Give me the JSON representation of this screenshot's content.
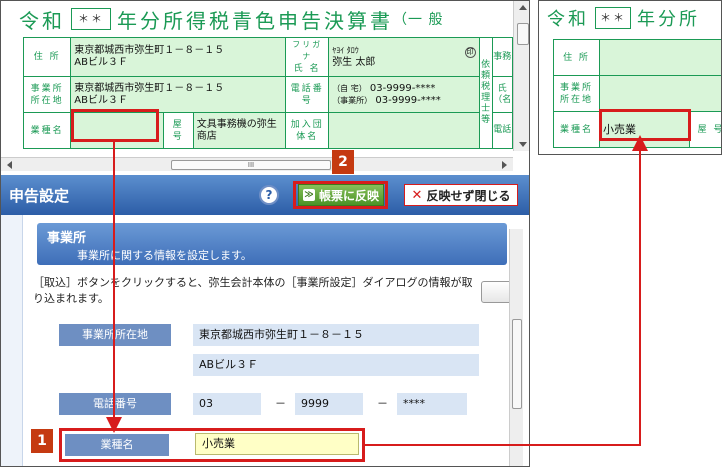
{
  "form": {
    "title_prefix": "令和",
    "era_value": "＊＊",
    "title_main": "年分所得税青色申告決算書",
    "title_kind": "（一 般",
    "labels": {
      "address": "住 所",
      "office_address": "事業所所在地",
      "business_type": "業種名",
      "shop_name": "屋 号",
      "association": "加入団体名",
      "furigana": "フリガナ",
      "name": "氏 名",
      "phone": "電話番号",
      "requester": "依頼税理士等",
      "office_right": "事務",
      "name_right": "氏（名",
      "phone_right": "電話"
    },
    "address_line1": "東京都城西市弥生町１－８－１５",
    "address_line2": "ABビル３Ｆ",
    "office_line1": "東京都城西市弥生町１－８－１５",
    "office_line2": "ABビル３Ｆ",
    "furigana_value": "ﾔﾖｲ ﾀﾛｳ",
    "name_value": "弥生 太郎",
    "seal": "印",
    "phone_home_label": "（自 宅）",
    "phone_home": "03-9999-****",
    "phone_office_label": "（事業所）",
    "phone_office": "03-9999-****",
    "business_type_value": "",
    "shop_value": "文具事務機の弥生商店",
    "scroll_grip": "III"
  },
  "zoom": {
    "title_prefix": "令和",
    "era_value": "＊＊",
    "title_main": "年分所",
    "address_label": "住 所",
    "office_label": "事業所所在地",
    "business_type_label": "業種名",
    "shop_label": "屋 号",
    "business_type_value": "小売業"
  },
  "panel": {
    "title": "申告設定",
    "help": "?",
    "apply_label": "帳票に反映",
    "apply_icon": "≫",
    "close_label": "反映せず閉じる",
    "close_icon": "✕",
    "section_title": "事業所",
    "section_desc": "事業所に関する情報を設定します。",
    "info": "［取込］ボタンをクリックすると、弥生会計本体の［事業所設定］ダイアログの情報が取り込まれます。",
    "fields": {
      "office_label": "事業所所在地",
      "office_line1": "東京都城西市弥生町１－８－１５",
      "office_line2": "ABビル３Ｆ",
      "phone_label": "電話番号",
      "phone1": "03",
      "phone2": "9999",
      "phone3": "****",
      "dash": "－",
      "business_label": "業種名",
      "business_value": "小売業"
    }
  },
  "badges": {
    "step1": "1",
    "step2": "2"
  },
  "colors": {
    "form_green": "#1b9a55",
    "highlight_red": "#d71c1c",
    "panel_blue": "#2c5da7",
    "badge": "#c53a11"
  }
}
